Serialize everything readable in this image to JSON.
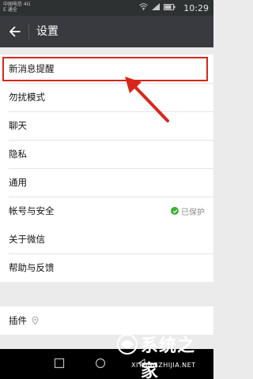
{
  "status_bar": {
    "carrier_line1": "中国电信 4G",
    "carrier_line2": "E 通全",
    "time": "10:29"
  },
  "app_bar": {
    "title": "设置",
    "back_icon": "arrow-left-icon"
  },
  "groups": {
    "main": {
      "items": [
        {
          "label": "新消息提醒"
        },
        {
          "label": "勿扰模式"
        },
        {
          "label": "聊天"
        },
        {
          "label": "隐私"
        },
        {
          "label": "通用"
        },
        {
          "label": "帐号与安全",
          "status": "已保护"
        }
      ]
    },
    "about": {
      "items": [
        {
          "label": "关于微信"
        },
        {
          "label": "帮助与反馈"
        }
      ]
    },
    "plugins": {
      "items": [
        {
          "label": "插件"
        }
      ]
    }
  },
  "watermark": {
    "brand": "系统之家",
    "url": "XITONGZHIJIA.NET"
  },
  "colors": {
    "app_bar": "#393a3f",
    "status_bar": "#2e3132",
    "highlight": "#d9261c",
    "protected_green": "#3cb034"
  }
}
